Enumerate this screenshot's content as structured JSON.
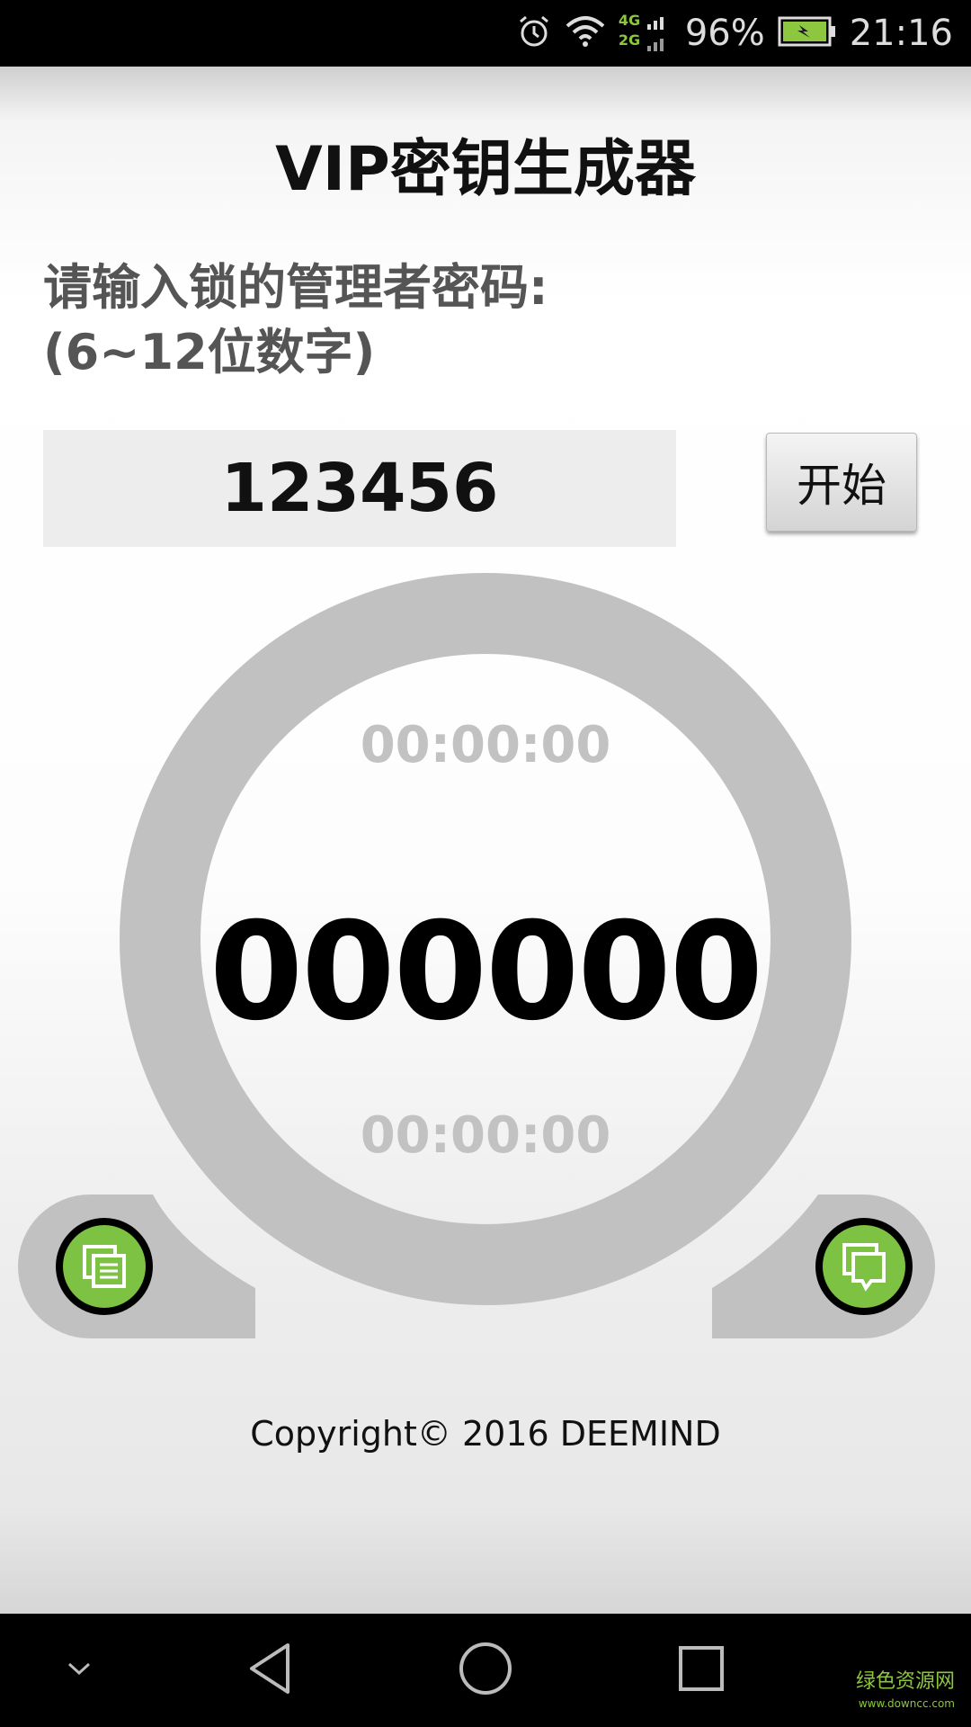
{
  "status_bar": {
    "battery_percent": "96%",
    "time": "21:16",
    "network_top": "4G",
    "network_bottom": "2G",
    "battery_color": "#8dc63f"
  },
  "app": {
    "title": "VIP密钥生成器",
    "prompt_line1": "请输入锁的管理者密码:",
    "prompt_line2": "(6~12位数字)",
    "password_value": "123456",
    "start_label": "开始",
    "time_top": "00:00:00",
    "code": "000000",
    "time_bottom": "00:00:00",
    "copyright": "Copyright© 2016 DEEMIND",
    "accent_color": "#7dc242"
  },
  "watermark": {
    "text": "绿色资源网",
    "url": "www.downcc.com"
  },
  "icons": {
    "left_button": "copy-list-icon",
    "right_button": "chat-copy-icon",
    "nav": [
      "chevron-down-icon",
      "back-icon",
      "home-icon",
      "recents-icon"
    ]
  }
}
